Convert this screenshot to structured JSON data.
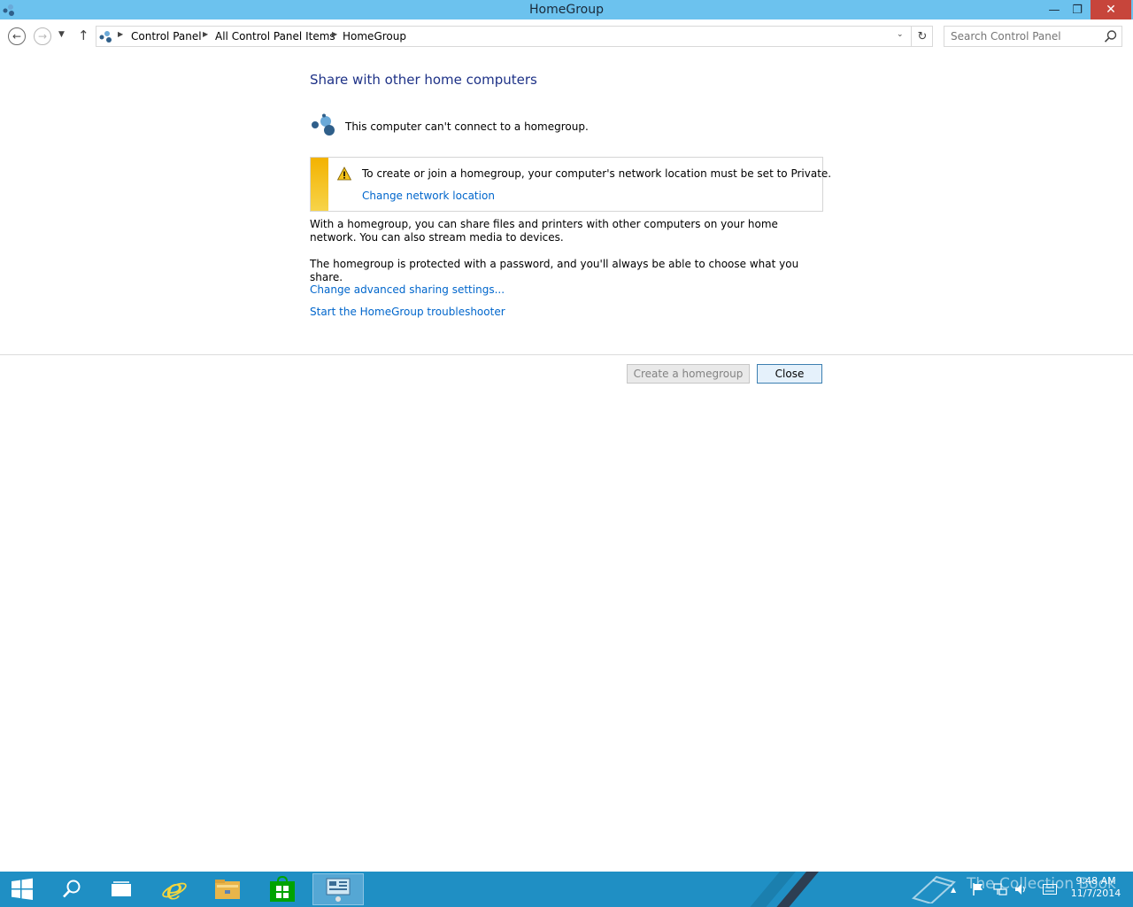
{
  "window": {
    "title": "HomeGroup",
    "minimize_glyph": "—",
    "restore_glyph": "❐",
    "close_glyph": "✕"
  },
  "navbar": {
    "back_glyph": "←",
    "forward_glyph": "→",
    "recent_glyph": "▼",
    "up_glyph": "↑",
    "breadcrumbs": [
      "Control Panel",
      "All Control Panel Items",
      "HomeGroup"
    ],
    "separator_glyph": "▶",
    "dropdown_glyph": "⌄",
    "refresh_glyph": "↻",
    "search_placeholder": "Search Control Panel"
  },
  "content": {
    "heading": "Share with other home computers",
    "status_text": "This computer can't connect to a homegroup.",
    "warning_text": "To create or join a homegroup, your computer's network location must be set to Private.",
    "warning_link": "Change network location",
    "paragraph1": "With a homegroup, you can share files and printers with other computers on your home network. You can also stream media to devices.",
    "paragraph2": "The homegroup is protected with a password, and you'll always be able to choose what you share.",
    "link_advanced": "Change advanced sharing settings...",
    "link_troubleshooter": "Start the HomeGroup troubleshooter"
  },
  "buttons": {
    "create": "Create a homegroup",
    "close": "Close"
  },
  "taskbar": {
    "watermark": "The Collection Book",
    "time": "9:48 AM",
    "date": "11/7/2014",
    "tray_expand_glyph": "▲"
  },
  "colors": {
    "titlebar": "#6cc2ee",
    "taskbar": "#1f8fc4",
    "heading": "#1e3287",
    "link": "#0066cc",
    "warning_stripe": "#f3b200"
  },
  "icons": [
    "homegroup-icon",
    "back-arrow-icon",
    "forward-arrow-icon",
    "up-arrow-icon",
    "refresh-icon",
    "search-icon",
    "warning-icon",
    "start-icon",
    "search-charm-icon",
    "task-view-icon",
    "internet-explorer-icon",
    "file-explorer-icon",
    "store-icon",
    "control-panel-icon",
    "flag-icon",
    "network-icon",
    "volume-icon",
    "keyboard-icon"
  ]
}
